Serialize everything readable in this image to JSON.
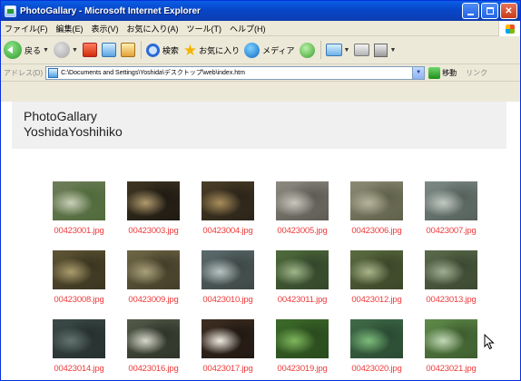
{
  "window": {
    "title": "PhotoGallary - Microsoft Internet Explorer"
  },
  "menu": [
    "ファイル(F)",
    "編集(E)",
    "表示(V)",
    "お気に入り(A)",
    "ツール(T)",
    "ヘルプ(H)"
  ],
  "toolbar": {
    "back_label": "戻る",
    "search_label": "検索",
    "favorites_label": "お気に入り",
    "media_label": "メディア"
  },
  "address": {
    "label": "アドレス(D)",
    "url": "C:\\Documents and Settings\\Yoshida\\デスクトップ\\web\\index.htm",
    "go_label": "移動",
    "links_label": "リンク"
  },
  "page": {
    "title": "PhotoGallary",
    "author": "YoshidaYoshihiko"
  },
  "gallery": {
    "rows": [
      [
        {
          "file": "00423001.jpg",
          "palette": [
            "#6f7d5a",
            "#c9d0b8",
            "#4f6a3a"
          ]
        },
        {
          "file": "00423003.jpg",
          "palette": [
            "#3f3522",
            "#b19a6d",
            "#1e1a12"
          ]
        },
        {
          "file": "00423004.jpg",
          "palette": [
            "#4a3d28",
            "#a98d5c",
            "#2a2418"
          ]
        },
        {
          "file": "00423005.jpg",
          "palette": [
            "#8d8a82",
            "#c9c6bd",
            "#5c5a52"
          ]
        },
        {
          "file": "00423006.jpg",
          "palette": [
            "#8b8b75",
            "#b7b49c",
            "#5f6049"
          ]
        },
        {
          "file": "00423007.jpg",
          "palette": [
            "#7c8a86",
            "#c2c9c3",
            "#55605a"
          ]
        }
      ],
      [
        {
          "file": "00423008.jpg",
          "palette": [
            "#5e5434",
            "#a99c6c",
            "#3a3420"
          ]
        },
        {
          "file": "00423009.jpg",
          "palette": [
            "#6e6646",
            "#a9a07a",
            "#423c28"
          ]
        },
        {
          "file": "00423010.jpg",
          "palette": [
            "#5b6a6c",
            "#b7c4c1",
            "#3d4745"
          ]
        },
        {
          "file": "00423011.jpg",
          "palette": [
            "#4f6b3c",
            "#9fb58a",
            "#33452a"
          ]
        },
        {
          "file": "00423012.jpg",
          "palette": [
            "#5a6b40",
            "#aab48a",
            "#3a4528"
          ]
        },
        {
          "file": "00423013.jpg",
          "palette": [
            "#5a6a4a",
            "#9fae92",
            "#3c4832"
          ]
        }
      ],
      [
        {
          "file": "00423014.jpg",
          "palette": [
            "#3b4a48",
            "#63736e",
            "#26302e"
          ]
        },
        {
          "file": "00423016.jpg",
          "palette": [
            "#535a48",
            "#d8d8cc",
            "#2d3328"
          ]
        },
        {
          "file": "00423017.jpg",
          "palette": [
            "#3d2e22",
            "#f0ece2",
            "#201812"
          ]
        },
        {
          "file": "00423019.jpg",
          "palette": [
            "#3c6a2a",
            "#7fb75c",
            "#2a4a1d"
          ]
        },
        {
          "file": "00423020.jpg",
          "palette": [
            "#3f6a48",
            "#7dbd7a",
            "#2a4a32"
          ]
        },
        {
          "file": "00423021.jpg",
          "palette": [
            "#5f8a4a",
            "#c2d8b8",
            "#3d5c2e"
          ]
        }
      ]
    ]
  },
  "colors": {
    "link": "#ee3a3a",
    "header_bg": "#f0f0f0",
    "titlebar": "#0a4fd4"
  }
}
